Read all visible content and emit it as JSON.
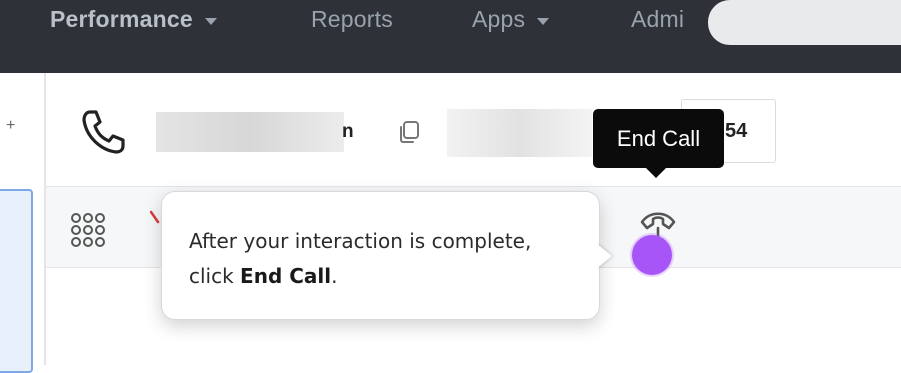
{
  "nav": {
    "items": [
      {
        "label": "Performance",
        "has_caret": true,
        "active": true
      },
      {
        "label": "Reports",
        "has_caret": false
      },
      {
        "label": "Apps",
        "has_caret": true
      },
      {
        "label": "Admi",
        "has_caret": false
      }
    ]
  },
  "call": {
    "caller_name_suffix": "n",
    "number_suffix": "54",
    "icons": [
      "phone-icon",
      "copy-icon",
      "keypad-icon",
      "end-call-icon"
    ]
  },
  "tooltip": {
    "label": "End Call"
  },
  "coach": {
    "text_prefix": "After your interaction is complete, click ",
    "bold": "End Call",
    "text_suffix": "."
  },
  "colors": {
    "nav_bg": "#2e3238",
    "hotspot": "#a855f7",
    "tooltip_bg": "#0b0b0b",
    "accent_blue": "#7ea8e6"
  }
}
